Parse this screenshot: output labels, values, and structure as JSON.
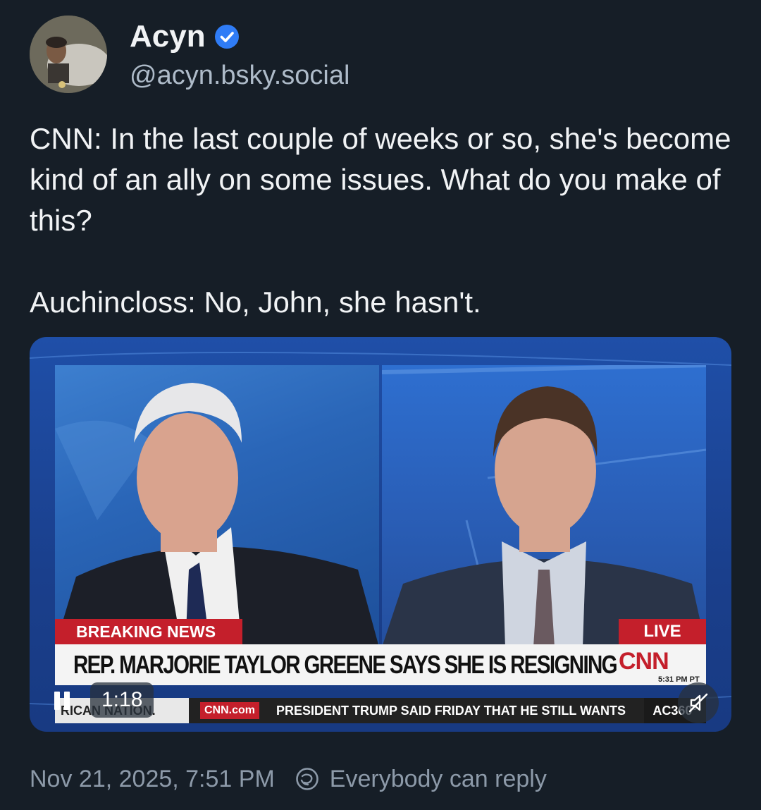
{
  "author": {
    "display_name": "Acyn",
    "handle": "@acyn.bsky.social",
    "verified": true
  },
  "post": {
    "text": "CNN: In the last couple of weeks or so, she's become kind of an ally on some issues. What do you make of this?\n\nAuchincloss: No, John, she hasn't."
  },
  "video": {
    "elapsed": "1:18",
    "playing": true,
    "muted": true,
    "frame": {
      "breaking_label": "BREAKING NEWS",
      "live_label": "LIVE",
      "headline": "REP. MARJORIE TAYLOR GREENE SAYS SHE IS RESIGNING",
      "network_logo": "CNN",
      "tv_time": "5:31 PM PT",
      "ticker_left": "RICAN NATION.",
      "ticker_site": "CNN.com",
      "ticker_text": "PRESIDENT TRUMP SAID FRIDAY THAT HE STILL WANTS",
      "ticker_right": "AC360°"
    }
  },
  "footer": {
    "timestamp": "Nov 21, 2025, 7:51 PM",
    "reply_setting": "Everybody can reply"
  },
  "colors": {
    "background": "#161e27",
    "verified_badge": "#2f7cf6",
    "secondary_text": "#8d9aa9",
    "cnn_red": "#c41f2b"
  }
}
